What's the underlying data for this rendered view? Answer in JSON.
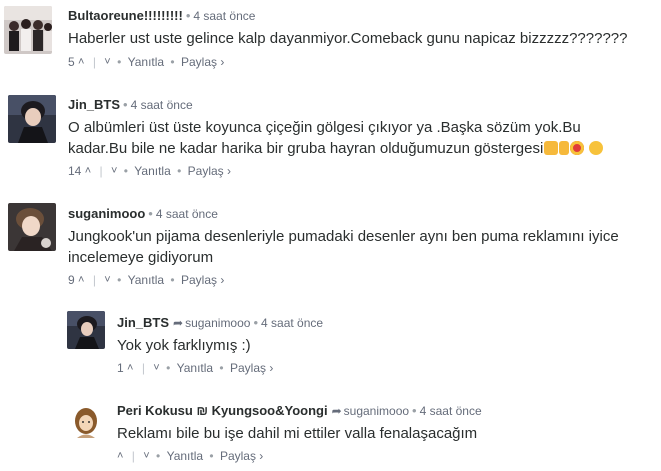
{
  "comments": [
    {
      "author": "Bultaoreune!!!!!!!!!",
      "time": "4 saat önce",
      "text": "Haberler ust uste gelince kalp dayanmiyor.Comeback gunu napicaz bizzzzz???????",
      "votes": "5",
      "reply": "Yanıtla",
      "share": "Paylaş ›"
    },
    {
      "author": "Jin_BTS",
      "time": "4 saat önce",
      "text": "O albümleri üst üste koyunca çiçeğin gölgesi çıkıyor ya .Başka sözüm yok.Bu kadar.Bu bile ne kadar harika bir gruba hayran olduğumuzun göstergesi",
      "votes": "14",
      "reply": "Yanıtla",
      "share": "Paylaş ›"
    },
    {
      "author": "suganimooo",
      "time": "4 saat önce",
      "text": "Jungkook'un pijama desenleriyle pumadaki desenler aynı ben puma reklamını iyice incelemeye gidiyorum",
      "votes": "9",
      "reply": "Yanıtla",
      "share": "Paylaş ›"
    },
    {
      "author": "Jin_BTS",
      "reply_to": "suganimooo",
      "time": "4 saat önce",
      "text": "Yok yok farklıymış :)",
      "votes": "1",
      "reply": "Yanıtla",
      "share": "Paylaş ›"
    },
    {
      "author": "Peri Kokusu ₪ Kyungsoo&Yoongi",
      "reply_to": "suganimooo",
      "time": "4 saat önce",
      "text": "Reklamı bile bu işe dahil mi ettiler valla fenalaşacağım",
      "votes": "",
      "reply": "Yanıtla",
      "share": "Paylaş ›"
    }
  ],
  "icons": {
    "upvote": "chevron-up-icon",
    "downvote": "chevron-down-icon",
    "reply_arrow": "reply-arrow-icon"
  }
}
